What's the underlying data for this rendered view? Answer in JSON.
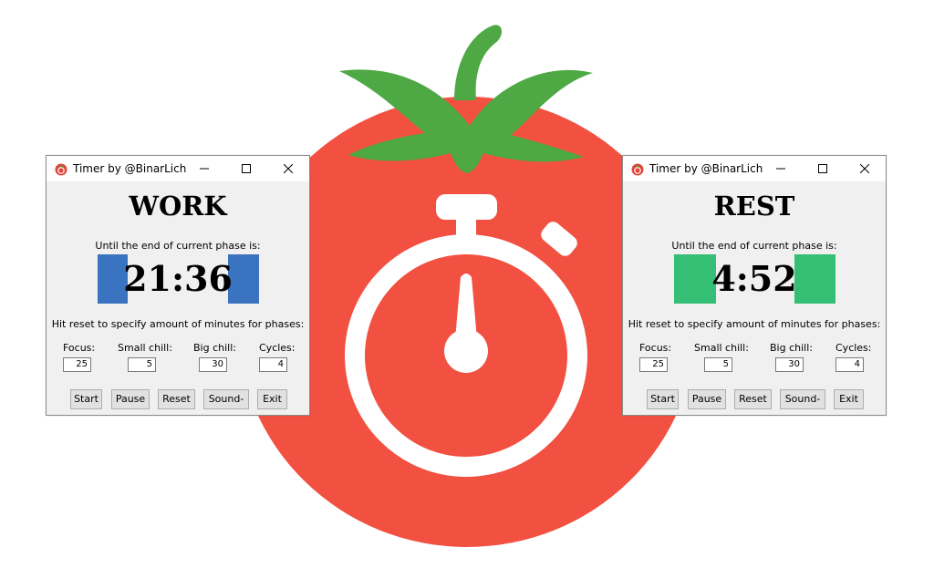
{
  "colors": {
    "tomato": "#f25041",
    "leaf": "#4ea844",
    "work_accent": "#3a73bf",
    "rest_accent": "#34bf75",
    "window_bg": "#f0f0f0"
  },
  "windows": [
    {
      "title": "Timer by @BinarLich",
      "phase": "WORK",
      "until_label": "Until the end of current phase is:",
      "time": "21:36",
      "accent": "#3a73bf",
      "hint": "Hit reset to specify amount of minutes for phases:",
      "fields": [
        {
          "label": "Focus:",
          "value": "25"
        },
        {
          "label": "Small chill:",
          "value": "5"
        },
        {
          "label": "Big chill:",
          "value": "30"
        },
        {
          "label": "Cycles:",
          "value": "4"
        }
      ],
      "buttons": [
        "Start",
        "Pause",
        "Reset",
        "Sound-",
        "Exit"
      ]
    },
    {
      "title": "Timer by @BinarLich",
      "phase": "REST",
      "until_label": "Until the end of current phase is:",
      "time": "4:52",
      "accent": "#34bf75",
      "hint": "Hit reset to specify amount of minutes for phases:",
      "fields": [
        {
          "label": "Focus:",
          "value": "25"
        },
        {
          "label": "Small chill:",
          "value": "5"
        },
        {
          "label": "Big chill:",
          "value": "30"
        },
        {
          "label": "Cycles:",
          "value": "4"
        }
      ],
      "buttons": [
        "Start",
        "Pause",
        "Reset",
        "Sound-",
        "Exit"
      ]
    }
  ],
  "icons": {
    "background": "tomato-stopwatch-icon",
    "app": "tomato-icon",
    "minimize": "minimize-icon",
    "maximize": "maximize-icon",
    "close": "close-icon"
  }
}
